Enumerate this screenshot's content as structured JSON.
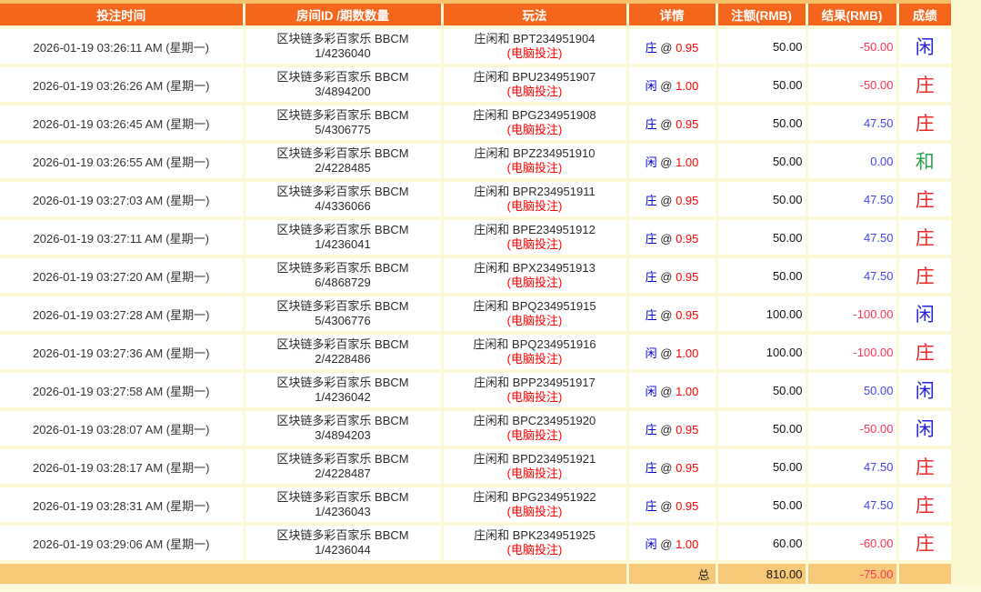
{
  "table": {
    "headers": [
      "投注时间",
      "房间ID /期数数量",
      "玩法",
      "详情",
      "注额(RMB)",
      "结果(RMB)",
      "成绩"
    ],
    "at_symbol": "@",
    "rows": [
      {
        "time": "2026-01-19 03:26:11 AM (星期一)",
        "room_name": "区块链多彩百家乐 BBCM",
        "room_period": "1/4236040",
        "play_name": "庄闲和 BPT234951904",
        "play_mode": "(电脑投注)",
        "pick": "庄",
        "rate": "0.95",
        "amount": "50.00",
        "result": "-50.00",
        "outcome": "闲"
      },
      {
        "time": "2026-01-19 03:26:26 AM (星期一)",
        "room_name": "区块链多彩百家乐 BBCM",
        "room_period": "3/4894200",
        "play_name": "庄闲和 BPU234951907",
        "play_mode": "(电脑投注)",
        "pick": "闲",
        "rate": "1.00",
        "amount": "50.00",
        "result": "-50.00",
        "outcome": "庄"
      },
      {
        "time": "2026-01-19 03:26:45 AM (星期一)",
        "room_name": "区块链多彩百家乐 BBCM",
        "room_period": "5/4306775",
        "play_name": "庄闲和 BPG234951908",
        "play_mode": "(电脑投注)",
        "pick": "庄",
        "rate": "0.95",
        "amount": "50.00",
        "result": "47.50",
        "outcome": "庄"
      },
      {
        "time": "2026-01-19 03:26:55 AM (星期一)",
        "room_name": "区块链多彩百家乐 BBCM",
        "room_period": "2/4228485",
        "play_name": "庄闲和 BPZ234951910",
        "play_mode": "(电脑投注)",
        "pick": "闲",
        "rate": "1.00",
        "amount": "50.00",
        "result": "0.00",
        "outcome": "和"
      },
      {
        "time": "2026-01-19 03:27:03 AM (星期一)",
        "room_name": "区块链多彩百家乐 BBCM",
        "room_period": "4/4336066",
        "play_name": "庄闲和 BPR234951911",
        "play_mode": "(电脑投注)",
        "pick": "庄",
        "rate": "0.95",
        "amount": "50.00",
        "result": "47.50",
        "outcome": "庄"
      },
      {
        "time": "2026-01-19 03:27:11 AM (星期一)",
        "room_name": "区块链多彩百家乐 BBCM",
        "room_period": "1/4236041",
        "play_name": "庄闲和 BPE234951912",
        "play_mode": "(电脑投注)",
        "pick": "庄",
        "rate": "0.95",
        "amount": "50.00",
        "result": "47.50",
        "outcome": "庄"
      },
      {
        "time": "2026-01-19 03:27:20 AM (星期一)",
        "room_name": "区块链多彩百家乐 BBCM",
        "room_period": "6/4868729",
        "play_name": "庄闲和 BPX234951913",
        "play_mode": "(电脑投注)",
        "pick": "庄",
        "rate": "0.95",
        "amount": "50.00",
        "result": "47.50",
        "outcome": "庄"
      },
      {
        "time": "2026-01-19 03:27:28 AM (星期一)",
        "room_name": "区块链多彩百家乐 BBCM",
        "room_period": "5/4306776",
        "play_name": "庄闲和 BPQ234951915",
        "play_mode": "(电脑投注)",
        "pick": "庄",
        "rate": "0.95",
        "amount": "100.00",
        "result": "-100.00",
        "outcome": "闲"
      },
      {
        "time": "2026-01-19 03:27:36 AM (星期一)",
        "room_name": "区块链多彩百家乐 BBCM",
        "room_period": "2/4228486",
        "play_name": "庄闲和 BPQ234951916",
        "play_mode": "(电脑投注)",
        "pick": "闲",
        "rate": "1.00",
        "amount": "100.00",
        "result": "-100.00",
        "outcome": "庄"
      },
      {
        "time": "2026-01-19 03:27:58 AM (星期一)",
        "room_name": "区块链多彩百家乐 BBCM",
        "room_period": "1/4236042",
        "play_name": "庄闲和 BPP234951917",
        "play_mode": "(电脑投注)",
        "pick": "闲",
        "rate": "1.00",
        "amount": "50.00",
        "result": "50.00",
        "outcome": "闲"
      },
      {
        "time": "2026-01-19 03:28:07 AM (星期一)",
        "room_name": "区块链多彩百家乐 BBCM",
        "room_period": "3/4894203",
        "play_name": "庄闲和 BPC234951920",
        "play_mode": "(电脑投注)",
        "pick": "庄",
        "rate": "0.95",
        "amount": "50.00",
        "result": "-50.00",
        "outcome": "闲"
      },
      {
        "time": "2026-01-19 03:28:17 AM (星期一)",
        "room_name": "区块链多彩百家乐 BBCM",
        "room_period": "2/4228487",
        "play_name": "庄闲和 BPD234951921",
        "play_mode": "(电脑投注)",
        "pick": "庄",
        "rate": "0.95",
        "amount": "50.00",
        "result": "47.50",
        "outcome": "庄"
      },
      {
        "time": "2026-01-19 03:28:31 AM (星期一)",
        "room_name": "区块链多彩百家乐 BBCM",
        "room_period": "1/4236043",
        "play_name": "庄闲和 BPG234951922",
        "play_mode": "(电脑投注)",
        "pick": "庄",
        "rate": "0.95",
        "amount": "50.00",
        "result": "47.50",
        "outcome": "庄"
      },
      {
        "time": "2026-01-19 03:29:06 AM (星期一)",
        "room_name": "区块链多彩百家乐 BBCM",
        "room_period": "1/4236044",
        "play_name": "庄闲和 BPK234951925",
        "play_mode": "(电脑投注)",
        "pick": "闲",
        "rate": "1.00",
        "amount": "60.00",
        "result": "-60.00",
        "outcome": "庄"
      }
    ],
    "total": {
      "label": "总",
      "amount": "810.00",
      "result": "-75.00"
    }
  },
  "colors": {
    "header_bg": "#F5661D",
    "top_strip": "#FBC169",
    "page_bg": "#FAF6CF",
    "total_row_bg": "#F7C877",
    "label_red": "#FF0000",
    "pick_blue": "#0000CC",
    "negative_result": "#FF3355",
    "positive_result": "#4147E8",
    "outcome": {
      "闲": "#2222DD",
      "庄": "#EE2828",
      "和": "#2EA24E"
    }
  }
}
